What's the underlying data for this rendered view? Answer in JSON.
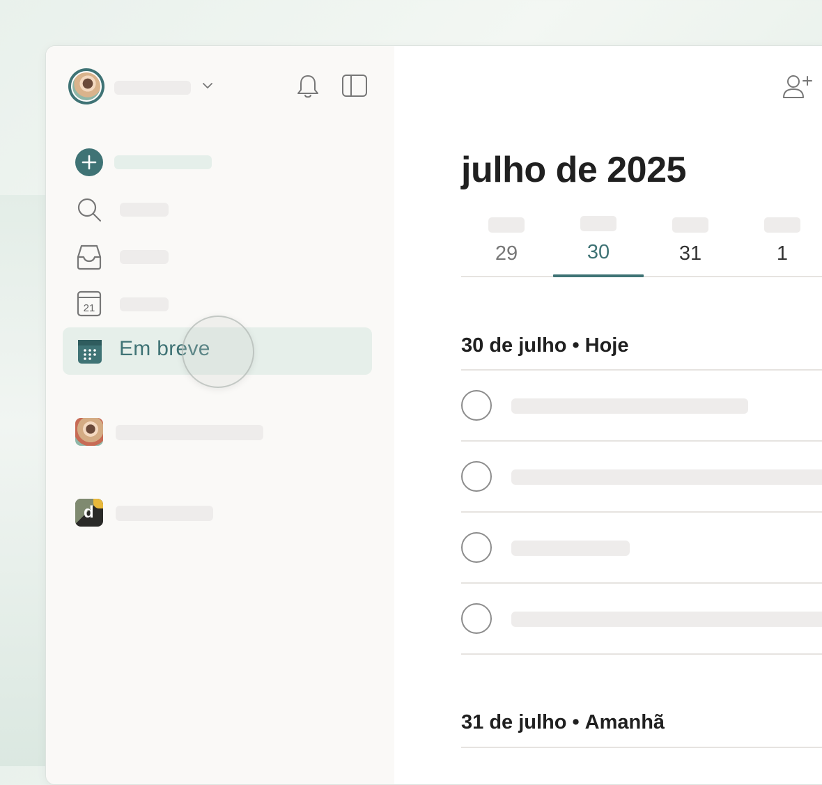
{
  "sidebar": {
    "nav_active_label": "Em breve",
    "calendar_icon_day": "21"
  },
  "main": {
    "title": "julho de 2025",
    "week_days": [
      {
        "num": "29",
        "state": "past"
      },
      {
        "num": "30",
        "state": "selected"
      },
      {
        "num": "31",
        "state": "future"
      },
      {
        "num": "1",
        "state": "future"
      }
    ],
    "sections": [
      {
        "date": "30 de julho",
        "sep": "•",
        "label": "Hoje"
      },
      {
        "date": "31 de julho",
        "sep": "•",
        "label": "Amanhã"
      }
    ]
  },
  "colors": {
    "accent": "#3f7375",
    "active_bg": "#e6efea",
    "placeholder": "#eeeceb"
  },
  "icons": [
    "user-avatar",
    "chevron-down-icon",
    "bell-icon",
    "sidebar-layout-icon",
    "plus-icon",
    "search-icon",
    "inbox-icon",
    "calendar-today-icon",
    "calendar-upcoming-icon",
    "add-person-icon"
  ]
}
